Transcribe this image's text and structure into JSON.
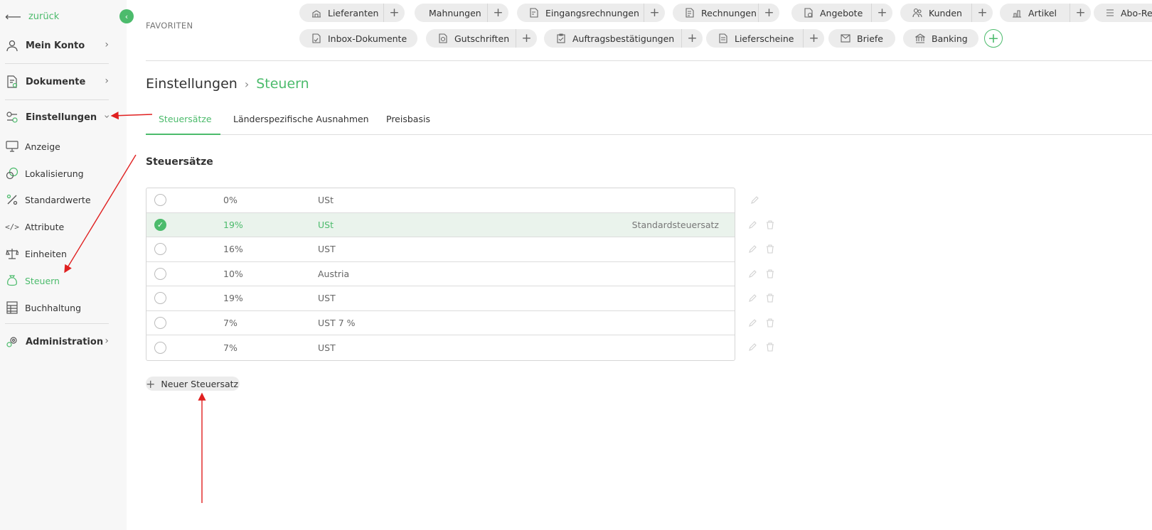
{
  "sidebar": {
    "back_label": "zurück",
    "collapse_icon": "chevron-left-icon",
    "main_items": [
      {
        "label": "Mein Konto",
        "icon": "user-icon"
      },
      {
        "label": "Dokumente",
        "icon": "document-icon"
      },
      {
        "label": "Einstellungen",
        "icon": "settings-icon"
      },
      {
        "label": "Administration",
        "icon": "admin-gear-icon"
      }
    ],
    "sub_items": [
      {
        "label": "Anzeige",
        "icon": "monitor-icon"
      },
      {
        "label": "Lokalisierung",
        "icon": "currency-icon"
      },
      {
        "label": "Standardwerte",
        "icon": "percent-icon"
      },
      {
        "label": "Attribute",
        "icon": "code-icon"
      },
      {
        "label": "Einheiten",
        "icon": "scale-icon"
      },
      {
        "label": "Steuern",
        "icon": "money-bag-icon"
      },
      {
        "label": "Buchhaltung",
        "icon": "ledger-icon"
      }
    ]
  },
  "favorites": {
    "label": "FAVORITEN",
    "row1": [
      {
        "label": "Lieferanten",
        "icon": "supplier-icon"
      },
      {
        "label": "Mahnungen",
        "icon": ""
      },
      {
        "label": "Eingangsrechnungen",
        "icon": "incoming-invoice-icon"
      },
      {
        "label": "Rechnungen",
        "icon": "invoice-icon"
      },
      {
        "label": "Angebote",
        "icon": "offer-icon"
      },
      {
        "label": "Kunden",
        "icon": "customers-icon"
      },
      {
        "label": "Artikel",
        "icon": "article-icon"
      },
      {
        "label": "Abo-Re",
        "icon": "subscription-icon"
      }
    ],
    "row2": [
      {
        "label": "Inbox-Dokumente",
        "icon": "inbox-icon"
      },
      {
        "label": "Gutschriften",
        "icon": "credit-note-icon"
      },
      {
        "label": "Auftragsbestätigungen",
        "icon": "order-confirmation-icon"
      },
      {
        "label": "Lieferscheine",
        "icon": "delivery-note-icon"
      },
      {
        "label": "Briefe",
        "icon": "mail-icon"
      },
      {
        "label": "Banking",
        "icon": "bank-icon"
      }
    ]
  },
  "breadcrumb": {
    "root": "Einstellungen",
    "current": "Steuern"
  },
  "tabs": [
    {
      "label": "Steuersätze",
      "active": true
    },
    {
      "label": "Länderspezifische Ausnahmen",
      "active": false
    },
    {
      "label": "Preisbasis",
      "active": false
    }
  ],
  "section_title": "Steuersätze",
  "tax_rates": [
    {
      "rate": "0%",
      "name": "USt",
      "note": "",
      "selected": false
    },
    {
      "rate": "19%",
      "name": "USt",
      "note": "Standardsteuersatz",
      "selected": true
    },
    {
      "rate": "16%",
      "name": "UST",
      "note": "",
      "selected": false
    },
    {
      "rate": "10%",
      "name": "Austria",
      "note": "",
      "selected": false
    },
    {
      "rate": "19%",
      "name": "UST",
      "note": "",
      "selected": false
    },
    {
      "rate": "7%",
      "name": "UST 7 %",
      "note": "",
      "selected": false
    },
    {
      "rate": "7%",
      "name": "UST",
      "note": "",
      "selected": false
    }
  ],
  "new_button_label": "Neuer Steuersatz",
  "colors": {
    "accent": "#4cbb6c",
    "annotation": "#e02020"
  }
}
